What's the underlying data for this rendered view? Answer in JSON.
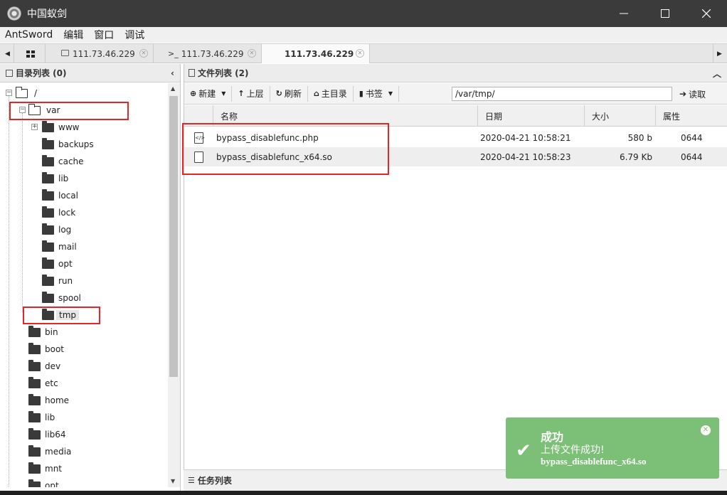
{
  "window": {
    "title": "中国蚁剑",
    "minimize": "—",
    "maximize": "☐",
    "close": "✕"
  },
  "menu": [
    "AntSword",
    "编辑",
    "窗口",
    "调试"
  ],
  "tabs": [
    {
      "label": "111.73.46.229",
      "icon": "folder-icon",
      "active": false
    },
    {
      "label": "111.73.46.229",
      "icon": "terminal-icon",
      "prefix": ">_",
      "active": false
    },
    {
      "label": "111.73.46.229",
      "icon": "none",
      "active": true
    }
  ],
  "left_panel": {
    "title": "目录列表 (0)",
    "root": "/",
    "var": "var",
    "var_children": [
      "www",
      "backups",
      "cache",
      "lib",
      "local",
      "lock",
      "log",
      "mail",
      "opt",
      "run",
      "spool",
      "tmp"
    ],
    "root_children": [
      "bin",
      "boot",
      "dev",
      "etc",
      "home",
      "lib",
      "lib64",
      "media",
      "mnt",
      "opt"
    ]
  },
  "right_panel": {
    "title": "文件列表 (2)",
    "toolbar": {
      "new": "新建",
      "up": "上层",
      "refresh": "刷新",
      "home": "主目录",
      "bookmark": "书签",
      "path": "/var/tmp/",
      "read": "读取"
    },
    "columns": {
      "name": "名称",
      "date": "日期",
      "size": "大小",
      "perm": "属性"
    },
    "files": [
      {
        "name": "bypass_disablefunc.php",
        "date": "2020-04-21 10:58:21",
        "size": "580 b",
        "perm": "0644",
        "icon": "php-file-icon"
      },
      {
        "name": "bypass_disablefunc_x64.so",
        "date": "2020-04-21 10:58:23",
        "size": "6.79 Kb",
        "perm": "0644",
        "icon": "file-icon"
      }
    ]
  },
  "task_panel": {
    "title": "任务列表"
  },
  "toast": {
    "title": "成功",
    "message": "上传文件成功!",
    "file": "bypass_disablefunc_x64.so",
    "color": "#7cbf76"
  },
  "colors": {
    "titlebar": "#3b3b3b",
    "annotation": "#e2262b"
  }
}
